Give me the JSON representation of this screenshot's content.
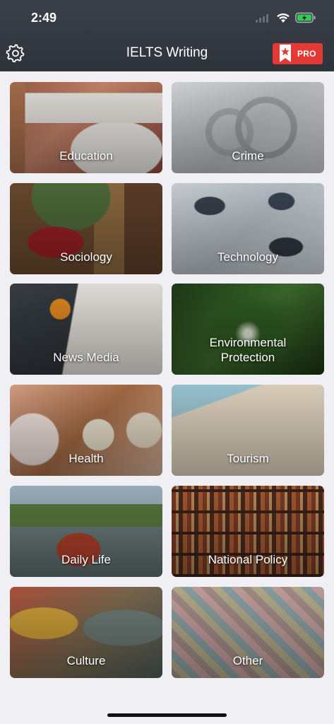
{
  "status_bar": {
    "time": "2:49"
  },
  "header": {
    "title": "IELTS Writing",
    "settings_icon": "gear-icon",
    "pro_label": "PRO",
    "pro_icon": "bookmark-star-icon",
    "accent": "#e53935"
  },
  "topics": [
    {
      "label": "Education"
    },
    {
      "label": "Crime"
    },
    {
      "label": "Sociology"
    },
    {
      "label": "Technology"
    },
    {
      "label": "News Media"
    },
    {
      "label": "Environmental Protection"
    },
    {
      "label": "Health"
    },
    {
      "label": "Tourism"
    },
    {
      "label": "Daily Life"
    },
    {
      "label": "National Policy"
    },
    {
      "label": "Culture"
    },
    {
      "label": "Other"
    }
  ],
  "colors": {
    "header_bg": "#343941",
    "page_bg": "#efeff4",
    "battery_green": "#34c759"
  }
}
